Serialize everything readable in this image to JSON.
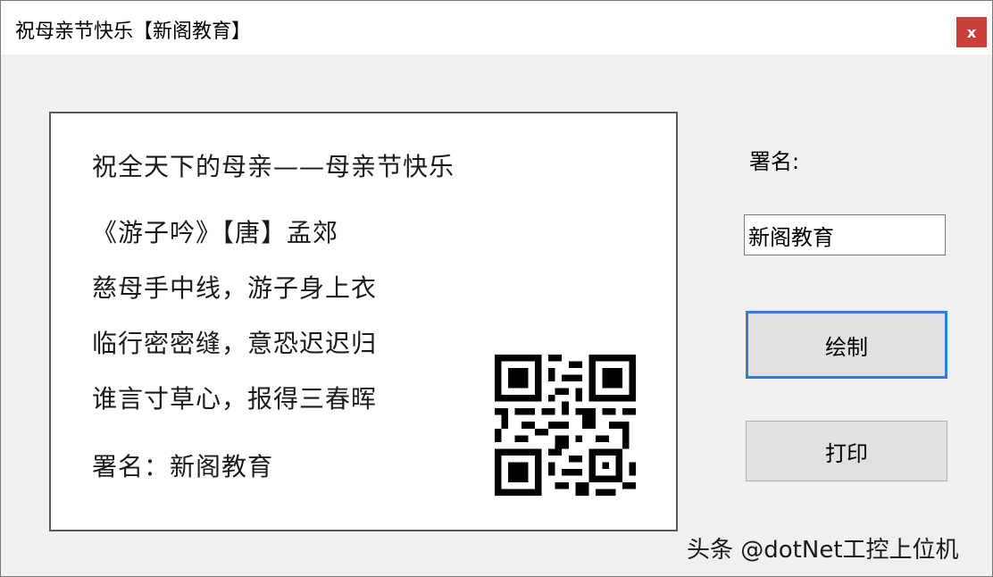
{
  "window": {
    "title": "祝母亲节快乐【新阁教育】",
    "close_label": "x"
  },
  "card": {
    "heading": "祝全天下的母亲——母亲节快乐",
    "poem_title": "《游子吟》【唐】孟郊",
    "lines": [
      "慈母手中线，游子身上衣",
      "临行密密缝，意恐迟迟归",
      "谁言寸草心，报得三春晖"
    ],
    "signature": "署名：新阁教育"
  },
  "form": {
    "sign_label": "署名:",
    "sign_value": "新阁教育",
    "draw_button": "绘制",
    "print_button": "打印"
  },
  "watermark": "头条 @dotNet工控上位机"
}
